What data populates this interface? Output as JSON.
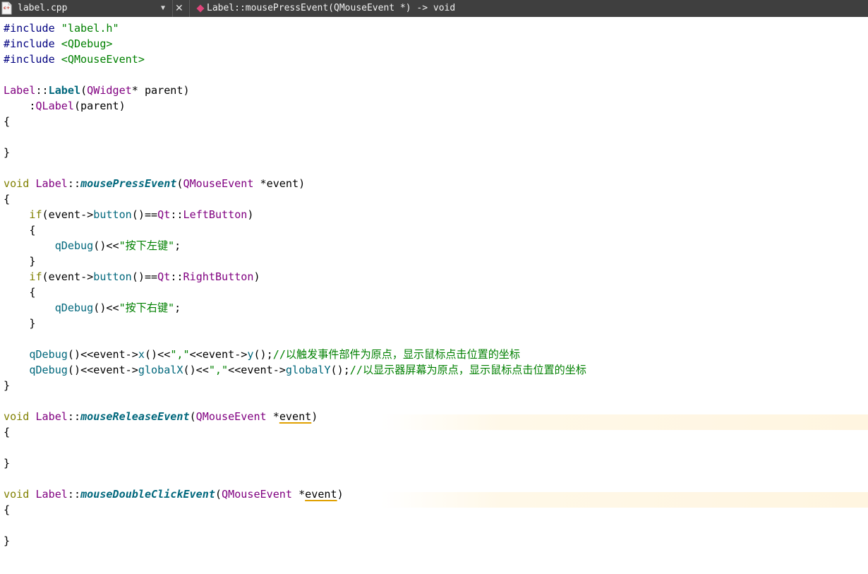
{
  "toolbar": {
    "file_name": "label.cpp",
    "file_icon": "cpp-file-icon",
    "dropdown_icon": "chevron-down-icon",
    "dropdown_glyph": "▼",
    "close_icon": "close-icon",
    "close_glyph": "✕",
    "symbol_icon": "function-symbol-icon",
    "symbol": "Label::mousePressEvent(QMouseEvent *) -> void"
  },
  "colors": {
    "toolbar_bg": "#3f3f3f",
    "keyword": "#808000",
    "type": "#800080",
    "function": "#00677c",
    "string": "#008000",
    "comment": "#008000",
    "enum": "#800080",
    "warning_underline": "#e0a000"
  },
  "editor": {
    "lines": [
      [
        {
          "t": "#include ",
          "c": "pre"
        },
        {
          "t": "\"label.h\"",
          "c": "str"
        }
      ],
      [
        {
          "t": "#include ",
          "c": "pre"
        },
        {
          "t": "<QDebug>",
          "c": "str"
        }
      ],
      [
        {
          "t": "#include ",
          "c": "pre"
        },
        {
          "t": "<QMouseEvent>",
          "c": "str"
        }
      ],
      [],
      [
        {
          "t": "Label",
          "c": "tp"
        },
        {
          "t": "::"
        },
        {
          "t": "Label",
          "c": "fnb"
        },
        {
          "t": "("
        },
        {
          "t": "QWidget",
          "c": "tp"
        },
        {
          "t": "* parent)"
        }
      ],
      [
        {
          "t": "    :"
        },
        {
          "t": "QLabel",
          "c": "tp"
        },
        {
          "t": "(parent)"
        }
      ],
      [
        {
          "t": "{"
        }
      ],
      [],
      [
        {
          "t": "}"
        }
      ],
      [],
      [
        {
          "t": "void",
          "c": "kw"
        },
        {
          "t": " "
        },
        {
          "t": "Label",
          "c": "tp"
        },
        {
          "t": "::"
        },
        {
          "t": "mousePressEvent",
          "c": "fnbi"
        },
        {
          "t": "("
        },
        {
          "t": "QMouseEvent",
          "c": "tp"
        },
        {
          "t": " *event)"
        }
      ],
      [
        {
          "t": "{"
        }
      ],
      [
        {
          "t": "    "
        },
        {
          "t": "if",
          "c": "kw"
        },
        {
          "t": "(event->"
        },
        {
          "t": "button",
          "c": "fn"
        },
        {
          "t": "()=="
        },
        {
          "t": "Qt",
          "c": "tp"
        },
        {
          "t": "::"
        },
        {
          "t": "LeftButton",
          "c": "en"
        },
        {
          "t": ")"
        }
      ],
      [
        {
          "t": "    {"
        }
      ],
      [
        {
          "t": "        "
        },
        {
          "t": "qDebug",
          "c": "fn"
        },
        {
          "t": "()<<"
        },
        {
          "t": "\"按下左键\"",
          "c": "str"
        },
        {
          "t": ";"
        }
      ],
      [
        {
          "t": "    }"
        }
      ],
      [
        {
          "t": "    "
        },
        {
          "t": "if",
          "c": "kw"
        },
        {
          "t": "(event->"
        },
        {
          "t": "button",
          "c": "fn"
        },
        {
          "t": "()=="
        },
        {
          "t": "Qt",
          "c": "tp"
        },
        {
          "t": "::"
        },
        {
          "t": "RightButton",
          "c": "en"
        },
        {
          "t": ")"
        }
      ],
      [
        {
          "t": "    {"
        }
      ],
      [
        {
          "t": "        "
        },
        {
          "t": "qDebug",
          "c": "fn"
        },
        {
          "t": "()<<"
        },
        {
          "t": "\"按下右键\"",
          "c": "str"
        },
        {
          "t": ";"
        }
      ],
      [
        {
          "t": "    }"
        }
      ],
      [],
      [
        {
          "t": "    "
        },
        {
          "t": "qDebug",
          "c": "fn"
        },
        {
          "t": "()<<event->"
        },
        {
          "t": "x",
          "c": "fn"
        },
        {
          "t": "()<<"
        },
        {
          "t": "\",\"",
          "c": "str"
        },
        {
          "t": "<<event->"
        },
        {
          "t": "y",
          "c": "fn"
        },
        {
          "t": "();"
        },
        {
          "t": "//以触发事件部件为原点，显示鼠标点击位置的坐标",
          "c": "cm"
        }
      ],
      [
        {
          "t": "    "
        },
        {
          "t": "qDebug",
          "c": "fn"
        },
        {
          "t": "()<<event->"
        },
        {
          "t": "globalX",
          "c": "fn"
        },
        {
          "t": "()<<"
        },
        {
          "t": "\",\"",
          "c": "str"
        },
        {
          "t": "<<event->"
        },
        {
          "t": "globalY",
          "c": "fn"
        },
        {
          "t": "();"
        },
        {
          "t": "//以显示器屏幕为原点，显示鼠标点击位置的坐标",
          "c": "cm"
        }
      ],
      [
        {
          "t": "}"
        }
      ],
      [],
      [
        {
          "t": "void",
          "c": "kw"
        },
        {
          "t": " "
        },
        {
          "t": "Label",
          "c": "tp"
        },
        {
          "t": "::"
        },
        {
          "t": "mouseReleaseEvent",
          "c": "fnbi"
        },
        {
          "t": "("
        },
        {
          "t": "QMouseEvent",
          "c": "tp"
        },
        {
          "t": " *"
        },
        {
          "t": "event",
          "c": "warn"
        },
        {
          "t": ")"
        }
      ],
      [
        {
          "t": "{"
        }
      ],
      [],
      [
        {
          "t": "}"
        }
      ],
      [],
      [
        {
          "t": "void",
          "c": "kw"
        },
        {
          "t": " "
        },
        {
          "t": "Label",
          "c": "tp"
        },
        {
          "t": "::"
        },
        {
          "t": "mouseDoubleClickEvent",
          "c": "fnbi"
        },
        {
          "t": "("
        },
        {
          "t": "QMouseEvent",
          "c": "tp"
        },
        {
          "t": " *"
        },
        {
          "t": "event",
          "c": "warn"
        },
        {
          "t": ")"
        }
      ],
      [
        {
          "t": "{"
        }
      ],
      [],
      [
        {
          "t": "}"
        }
      ]
    ]
  }
}
